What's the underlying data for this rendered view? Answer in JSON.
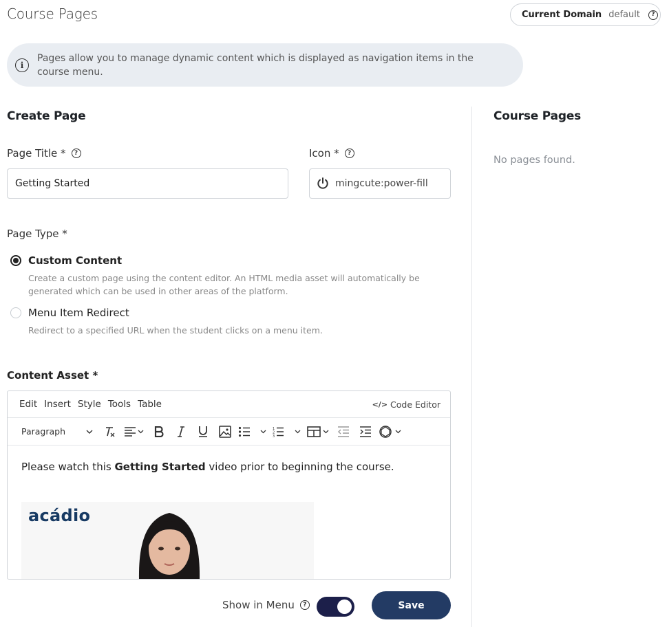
{
  "header": {
    "title": "Course Pages",
    "domain_label": "Current Domain",
    "domain_value": "default"
  },
  "info": {
    "text": "Pages allow you to manage dynamic content which is displayed as navigation items in the course menu."
  },
  "create": {
    "title": "Create Page",
    "page_title_label": "Page Title *",
    "page_title_value": "Getting Started",
    "icon_label": "Icon *",
    "icon_value": "mingcute:power-fill",
    "icon_name": "power-icon",
    "page_type_label": "Page Type *",
    "options": [
      {
        "label": "Custom Content",
        "description": "Create a custom page using the content editor. An HTML media asset will automatically be generated which can be used in other areas of the platform.",
        "selected": true
      },
      {
        "label": "Menu Item Redirect",
        "description": "Redirect to a specified URL when the student clicks on a menu item.",
        "selected": false
      }
    ],
    "content_asset_label": "Content Asset *"
  },
  "editor": {
    "menus": [
      "Edit",
      "Insert",
      "Style",
      "Tools",
      "Table"
    ],
    "code_editor": "Code Editor",
    "block_format": "Paragraph",
    "content_prefix": "Please watch this ",
    "content_bold": "Getting Started",
    "content_suffix": " video prior to beginning the course.",
    "brand": "acádio"
  },
  "footer": {
    "show_in_menu_label": "Show in Menu",
    "show_in_menu": true,
    "save_label": "Save"
  },
  "sidebar": {
    "title": "Course Pages",
    "empty_text": "No pages found."
  },
  "colors": {
    "primary": "#233b64",
    "toggle_on": "#1c1f4a",
    "banner_bg": "#e9edf2"
  }
}
